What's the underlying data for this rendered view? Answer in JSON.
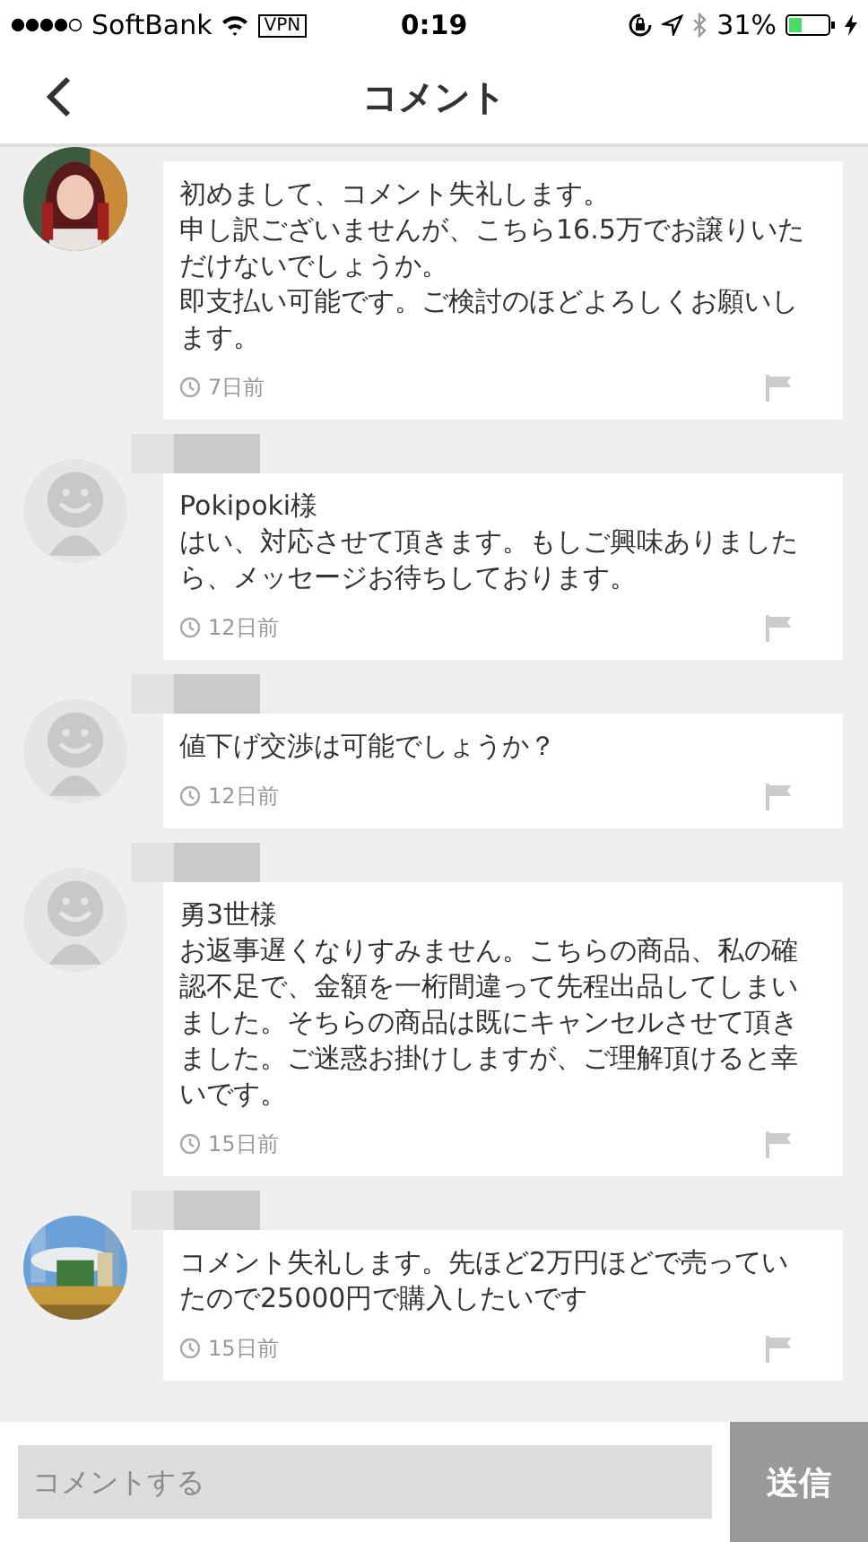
{
  "status_bar": {
    "carrier": "SoftBank",
    "vpn": "VPN",
    "time": "0:19",
    "battery": "31%"
  },
  "nav": {
    "title": "コメント"
  },
  "comments": [
    {
      "kind": "picture",
      "redacted_name": false,
      "paragraphs": [
        "初めまして、コメント失礼します。",
        "申し訳ございませんが、こちら16.5万でお譲りいただけないでしょうか。",
        "即支払い可能です。ご検討のほどよろしくお願いします。"
      ],
      "time": "7日前"
    },
    {
      "kind": "default",
      "redacted_name": true,
      "paragraphs": [
        "Pokipoki様",
        "はい、対応させて頂きます。もしご興味ありましたら、メッセージお待ちしております。"
      ],
      "time": "12日前"
    },
    {
      "kind": "default",
      "redacted_name": true,
      "paragraphs": [
        "値下げ交渉は可能でしょうか？"
      ],
      "time": "12日前"
    },
    {
      "kind": "default",
      "redacted_name": true,
      "paragraphs": [
        "勇3世様",
        "お返事遅くなりすみません。こちらの商品、私の確認不足で、金額を一桁間違って先程出品してしまいました。そちらの商品は既にキャンセルさせて頂きました。ご迷惑お掛けしますが、ご理解頂けると幸いです。"
      ],
      "time": "15日前"
    },
    {
      "kind": "picture",
      "redacted_name": true,
      "paragraphs": [
        "コメント失礼します。先ほど2万円ほどで売っていたので25000円で購入したいです"
      ],
      "time": "15日前"
    }
  ],
  "composer": {
    "placeholder": "コメントする",
    "send": "送信"
  }
}
